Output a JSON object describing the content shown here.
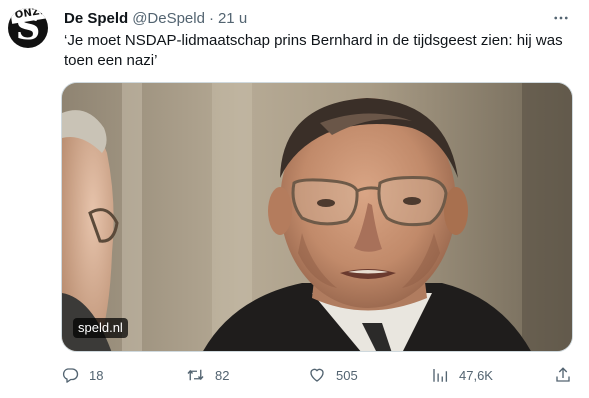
{
  "account": {
    "display_name": "De Speld",
    "handle": "@DeSpeld",
    "separator": "·",
    "time": "21 u",
    "avatar_letter": "S",
    "avatar_banner": "ONZEEKT"
  },
  "tweet": {
    "text": "‘Je moet NSDAP-lidmaatschap prins Bernhard in de tijdsgeest zien: hij was toen een nazi’"
  },
  "media": {
    "source_label": "speld.nl"
  },
  "actions": {
    "replies": "18",
    "reposts": "82",
    "likes": "505",
    "views": "47,6K"
  },
  "icons": {
    "more": "more-horizontal-icon",
    "reply": "reply-icon",
    "repost": "repost-icon",
    "like": "heart-icon",
    "views": "views-chart-icon",
    "share": "share-icon"
  },
  "colors": {
    "text_primary": "#0f1419",
    "text_secondary": "#536471",
    "border": "#cfd9de"
  }
}
